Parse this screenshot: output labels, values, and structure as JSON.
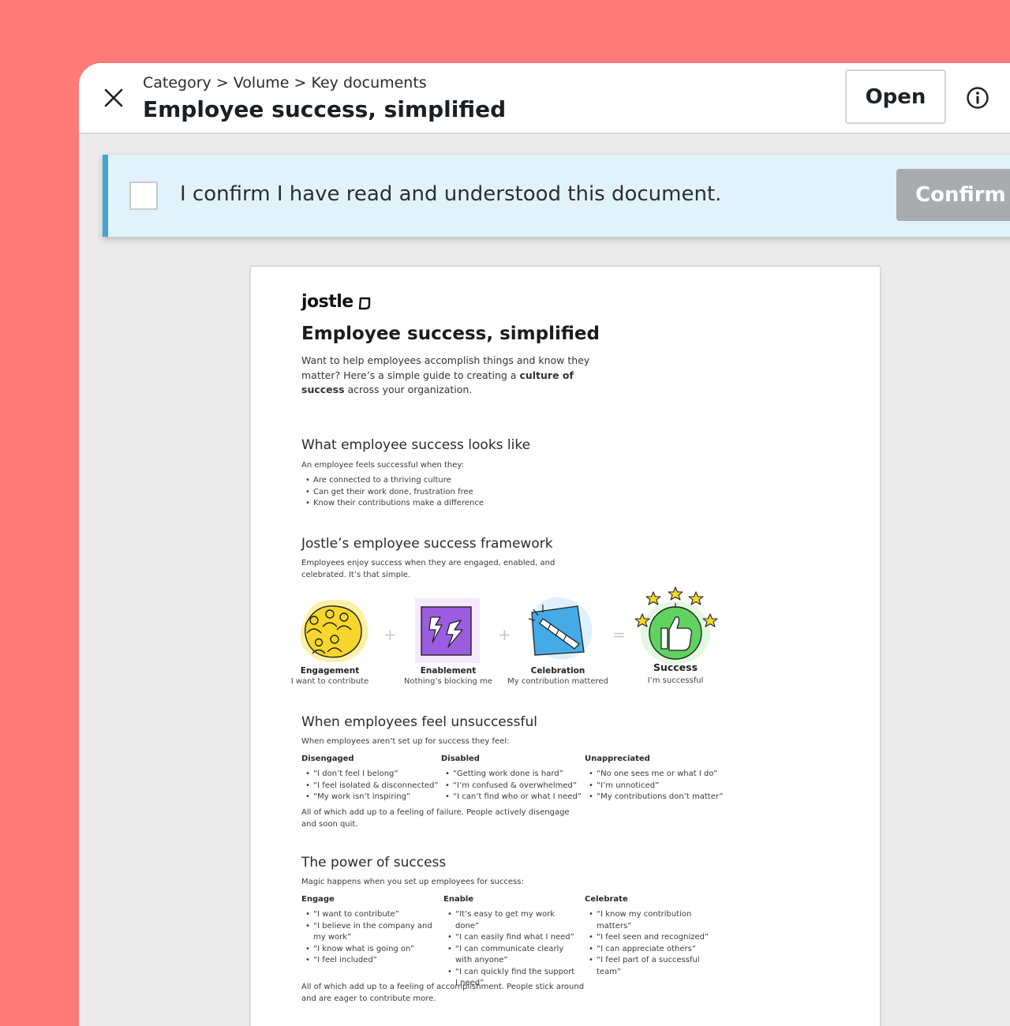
{
  "header": {
    "breadcrumb": "Category > Volume > Key documents",
    "title": "Employee success, simplified",
    "open_label": "Open"
  },
  "confirm": {
    "text": "I confirm I have read and understood this document.",
    "button_label": "Confirm"
  },
  "document": {
    "logo": "jostle",
    "title": "Employee success, simplified",
    "intro_part1": "Want to help employees accomplish things and know they matter? Here’s a simple guide to creating a ",
    "intro_bold1": "culture of success",
    "intro_part2": " across your organization.",
    "section1": {
      "heading": "What employee success looks like",
      "lead": "An employee feels successful when they:",
      "bullets": [
        "Are connected to a thriving culture",
        "Can get their work done, frustration free",
        "Know their contributions make a difference"
      ]
    },
    "section2": {
      "heading": "Jostle’s employee success framework",
      "lead": "Employees enjoy success when they are engaged, enabled, and celebrated. It’s that simple.",
      "items": [
        {
          "label": "Engagement",
          "sub": "I want to contribute"
        },
        {
          "label": "Enablement",
          "sub": "Nothing’s blocking me"
        },
        {
          "label": "Celebration",
          "sub": "My contribution mattered"
        },
        {
          "label": "Success",
          "sub": "I’m successful"
        }
      ],
      "plus": "+",
      "equals": "="
    },
    "section3": {
      "heading": "When employees feel unsuccessful",
      "lead": "When employees aren’t set up for success they feel:",
      "columns": [
        {
          "title": "Disengaged",
          "items": [
            "“I don’t feel I belong”",
            "“I feel isolated & disconnected”",
            "“My work isn’t inspiring”"
          ]
        },
        {
          "title": "Disabled",
          "items": [
            "“Getting work done is hard”",
            "“I’m confused & overwhelmed”",
            "“I can’t find who or what I need”"
          ]
        },
        {
          "title": "Unappreciated",
          "items": [
            "“No one sees me or what I do”",
            "“I’m unnoticed”",
            "“My contributions don’t matter”"
          ]
        }
      ],
      "closing": "All of which add up to a feeling of failure. People actively disengage and soon quit."
    },
    "section4": {
      "heading": "The power of success",
      "lead": "Magic happens when you set up employees for success:",
      "columns": [
        {
          "title": "Engage",
          "items": [
            "“I want to contribute”",
            "“I believe in the company and my work”",
            "“I know what is going on”",
            "“I feel included”"
          ]
        },
        {
          "title": "Enable",
          "items": [
            "“It’s easy to get my work done”",
            "“I can easily find what I need”",
            "“I can communicate clearly with anyone”",
            "“I can quickly find the support I need”"
          ]
        },
        {
          "title": "Celebrate",
          "items": [
            "“I know my contribution matters”",
            "“I feel seen and recognized”",
            "“I can appreciate others”",
            "“I feel part of a successful team”"
          ]
        }
      ],
      "closing": "All of which add up to a feeling of accomplishment. People stick around and are eager to contribute more."
    }
  },
  "icons": {
    "close": "close-icon",
    "info": "info-icon",
    "engagement": "people-group-icon",
    "enablement": "lightning-icon",
    "celebration": "party-popper-icon",
    "success": "thumbs-up-stars-icon"
  },
  "colors": {
    "background": "#ff7b78",
    "confirm_accent": "#3fa3db",
    "confirm_bar": "#e2f2fa",
    "confirm_button": "#a8acae",
    "engagement": "#f6d62a",
    "enablement": "#9b5ce0",
    "celebration": "#45abe6",
    "success": "#5fd260"
  }
}
